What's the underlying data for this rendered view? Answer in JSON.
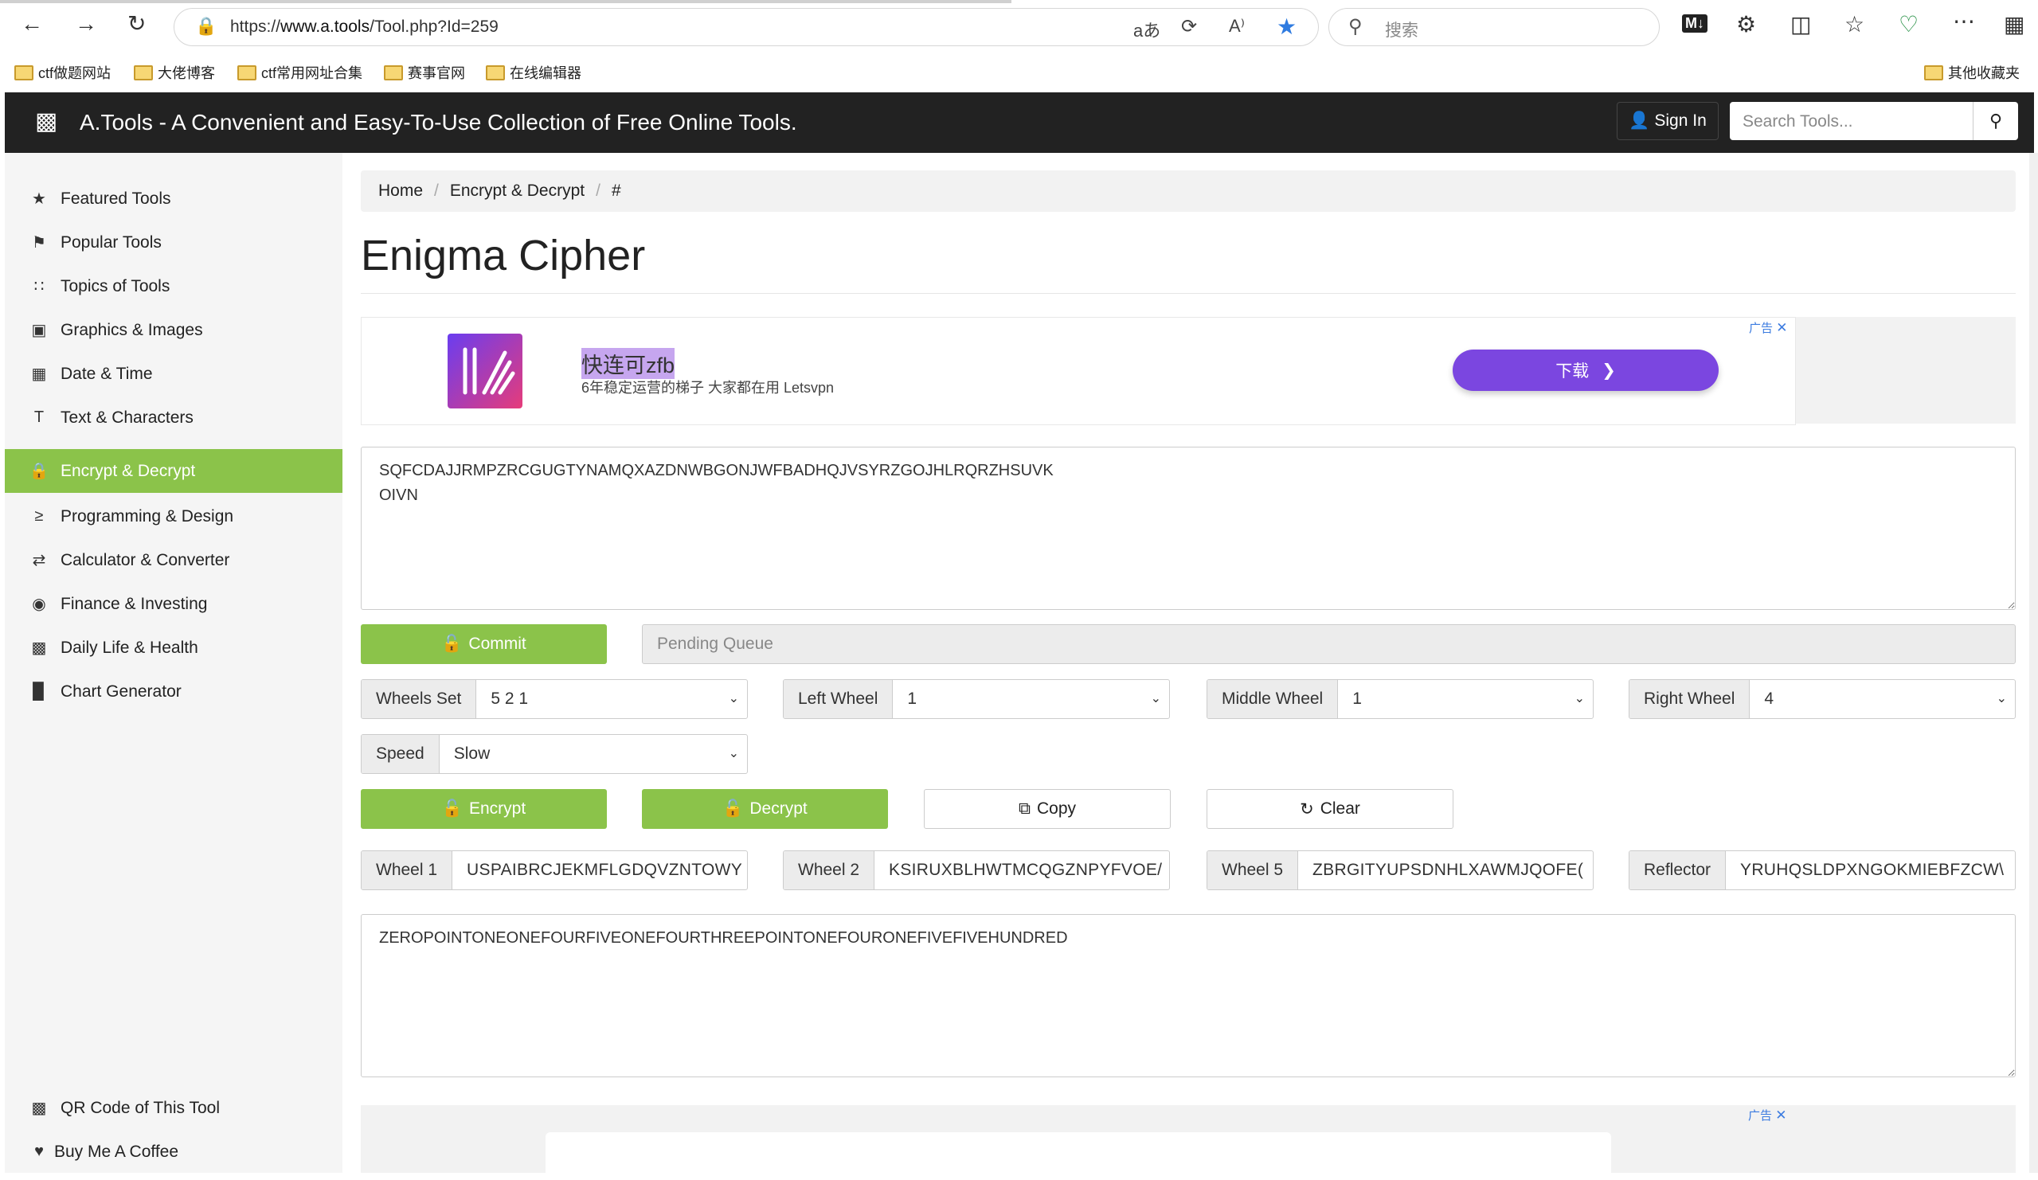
{
  "browser": {
    "url_prefix": "https://",
    "url_host": "www.a.tools",
    "url_path": "/Tool.php?Id=259",
    "search_placeholder": "搜索",
    "bookmarks": [
      "ctf做题网站",
      "大佬博客",
      "ctf常用网址合集",
      "赛事官网",
      "在线编辑器"
    ],
    "bookmarks_other": "其他收藏夹"
  },
  "site": {
    "title": "A.Tools - A Convenient and Easy-To-Use Collection of Free Online Tools.",
    "signin": "Sign In",
    "search_placeholder": "Search Tools..."
  },
  "sidebar": {
    "items": [
      {
        "label": "Featured Tools",
        "icon": "star-icon"
      },
      {
        "label": "Popular Tools",
        "icon": "flag-icon"
      },
      {
        "label": "Topics of Tools",
        "icon": "grid-icon"
      },
      {
        "label": "Graphics & Images",
        "icon": "image-icon"
      },
      {
        "label": "Date & Time",
        "icon": "calendar-icon"
      },
      {
        "label": "Text & Characters",
        "icon": "text-icon"
      },
      {
        "label": "Encrypt & Decrypt",
        "icon": "lock-icon",
        "active": true
      },
      {
        "label": "Programming & Design",
        "icon": "terminal-icon"
      },
      {
        "label": "Calculator & Converter",
        "icon": "exchange-icon"
      },
      {
        "label": "Finance & Investing",
        "icon": "piggy-bank-icon"
      },
      {
        "label": "Daily Life & Health",
        "icon": "qr-grid-icon"
      },
      {
        "label": "Chart Generator",
        "icon": "bar-chart-icon"
      }
    ],
    "bottom": [
      {
        "label": "QR Code of This Tool",
        "icon": "qrcode-icon"
      },
      {
        "label": "Buy Me A Coffee",
        "icon": "heart-icon"
      }
    ]
  },
  "breadcrumb": [
    "Home",
    "Encrypt & Decrypt",
    "#"
  ],
  "page_title": "Enigma Cipher",
  "ad": {
    "title": "快连可zfb",
    "subtitle": "6年稳定运营的梯子 大家都在用 Letsvpn",
    "button": "下载",
    "tag": "广告"
  },
  "input_text": "SQFCDAJJRMPZRCGUGTYNAMQXAZDNWBGONJWFBADHQJVSYRZGOJHLRQRZHSUVK\nOIVN",
  "commit_label": "Commit",
  "pending_placeholder": "Pending Queue",
  "settings": {
    "wheels_set": {
      "label": "Wheels Set",
      "value": "5 2 1"
    },
    "left_wheel": {
      "label": "Left Wheel",
      "value": "1"
    },
    "middle_wheel": {
      "label": "Middle Wheel",
      "value": "1"
    },
    "right_wheel": {
      "label": "Right Wheel",
      "value": "4"
    },
    "speed": {
      "label": "Speed",
      "value": "Slow"
    }
  },
  "buttons": {
    "encrypt": "Encrypt",
    "decrypt": "Decrypt",
    "copy": "Copy",
    "clear": "Clear"
  },
  "wheels": {
    "w1": {
      "label": "Wheel 1",
      "value": "USPAIBRCJEKMFLGDQVZNTOWY"
    },
    "w2": {
      "label": "Wheel 2",
      "value": "KSIRUXBLHWTMCQGZNPYFVOE/"
    },
    "w5": {
      "label": "Wheel 5",
      "value": "ZBRGITYUPSDNHLXAWMJQOFE("
    },
    "reflector": {
      "label": "Reflector",
      "value": "YRUHQSLDPXNGOKMIEBFZCW\\"
    }
  },
  "output_text": "ZEROPOINTONEONEFOURFIVEONEFOURTHREEPOINTONEFOURONEFIVEFIVEHUNDRED",
  "colors": {
    "accent": "#8bc34a",
    "header": "#222222",
    "ad_button": "#7b46e0"
  }
}
